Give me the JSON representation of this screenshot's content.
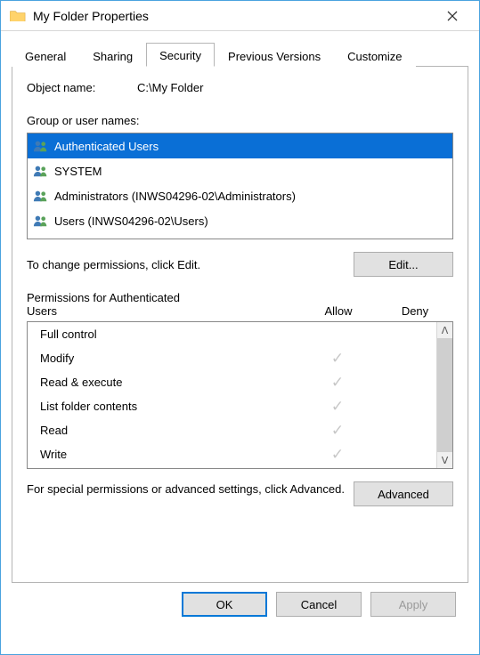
{
  "window": {
    "title": "My Folder Properties",
    "close_label": "Close"
  },
  "tabs": [
    {
      "label": "General"
    },
    {
      "label": "Sharing"
    },
    {
      "label": "Security",
      "active": true
    },
    {
      "label": "Previous Versions"
    },
    {
      "label": "Customize"
    }
  ],
  "security": {
    "object_name_label": "Object name:",
    "object_name_value": "C:\\My Folder",
    "group_label": "Group or user names:",
    "groups": [
      {
        "name": "Authenticated Users",
        "selected": true
      },
      {
        "name": "SYSTEM"
      },
      {
        "name": "Administrators (INWS04296-02\\Administrators)"
      },
      {
        "name": "Users (INWS04296-02\\Users)"
      }
    ],
    "edit_hint": "To change permissions, click Edit.",
    "edit_button": "Edit...",
    "perm_title_prefix": "Permissions for Authenticated",
    "perm_title_line2": "Users",
    "allow_label": "Allow",
    "deny_label": "Deny",
    "permissions": [
      {
        "name": "Full control",
        "allow": false,
        "deny": false
      },
      {
        "name": "Modify",
        "allow": true,
        "deny": false
      },
      {
        "name": "Read & execute",
        "allow": true,
        "deny": false
      },
      {
        "name": "List folder contents",
        "allow": true,
        "deny": false
      },
      {
        "name": "Read",
        "allow": true,
        "deny": false
      },
      {
        "name": "Write",
        "allow": true,
        "deny": false
      }
    ],
    "advanced_hint": "For special permissions or advanced settings, click Advanced.",
    "advanced_button": "Advanced"
  },
  "buttons": {
    "ok": "OK",
    "cancel": "Cancel",
    "apply": "Apply"
  }
}
